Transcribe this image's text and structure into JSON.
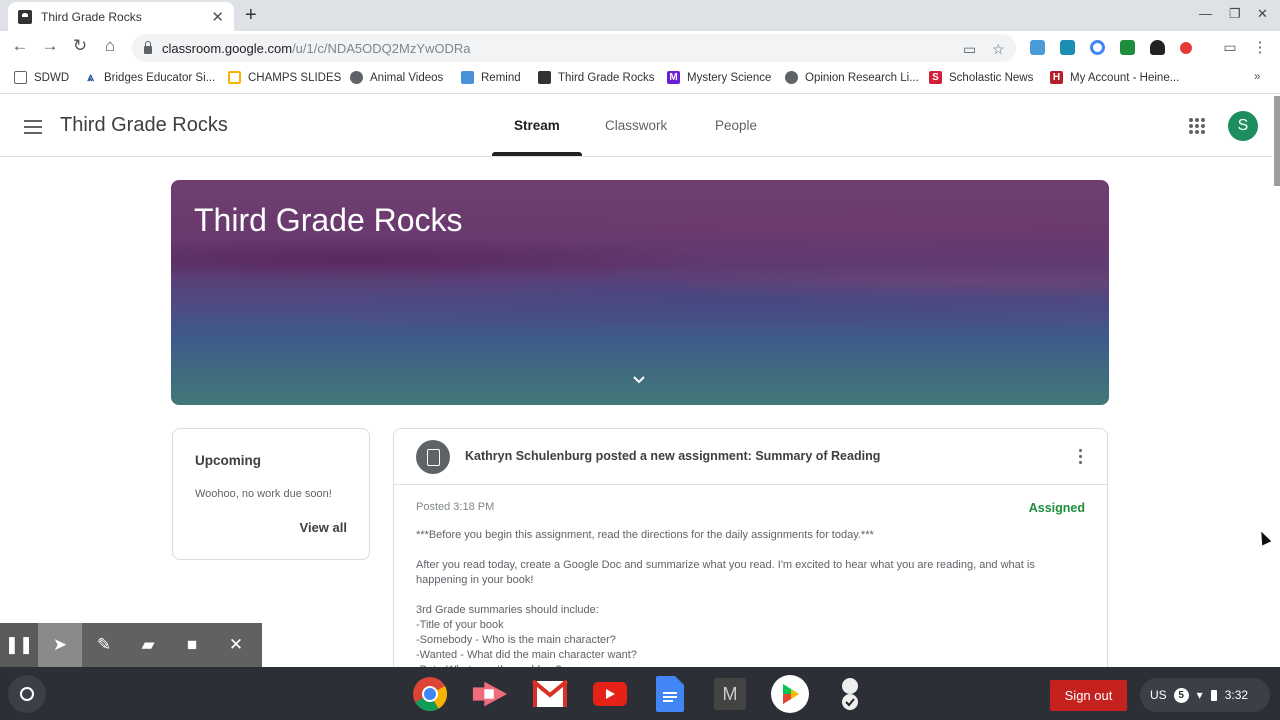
{
  "browser": {
    "tab_title": "Third Grade Rocks",
    "url_host": "classroom.google.com",
    "url_path": "/u/1/c/NDA5ODQ2MzYwODRa",
    "bookmarks": [
      {
        "label": "SDWD",
        "icon": "folder-icon"
      },
      {
        "label": "Bridges Educator Si...",
        "icon": "bridges-icon"
      },
      {
        "label": "CHAMPS SLIDES",
        "icon": "slides-icon"
      },
      {
        "label": "Animal Videos",
        "icon": "globe-icon"
      },
      {
        "label": "Remind",
        "icon": "remind-icon"
      },
      {
        "label": "Third Grade Rocks",
        "icon": "classroom-icon"
      },
      {
        "label": "Mystery Science",
        "icon": "mystery-science-icon"
      },
      {
        "label": "Opinion Research Li...",
        "icon": "globe-icon"
      },
      {
        "label": "Scholastic News",
        "icon": "scholastic-icon"
      },
      {
        "label": "My Account - Heine...",
        "icon": "heinemann-icon"
      }
    ],
    "more_bookmarks": "»"
  },
  "classroom": {
    "class_name": "Third Grade Rocks",
    "tabs": [
      {
        "label": "Stream",
        "active": true
      },
      {
        "label": "Classwork",
        "active": false
      },
      {
        "label": "People",
        "active": false
      }
    ],
    "avatar_letter": "S",
    "banner_title": "Third Grade Rocks",
    "upcoming": {
      "title": "Upcoming",
      "text": "Woohoo, no work due soon!",
      "link": "View all"
    },
    "post": {
      "title": "Kathryn Schulenburg posted a new assignment: Summary of Reading",
      "posted": "Posted 3:18 PM",
      "status": "Assigned",
      "body": "***Before you begin this assignment, read the directions for the daily assignments for today.***\n\nAfter you read today, create a Google Doc and summarize what you read. I'm excited to hear what you are reading, and what is happening in your book!\n\n3rd Grade summaries should include:\n-Title of your book\n-Somebody - Who is the main character?\n-Wanted - What did the main character want?\n-But - What was the problem?"
    }
  },
  "shelf": {
    "sign_out": "Sign out",
    "ime": "US",
    "notifications": "5",
    "time": "3:32"
  }
}
